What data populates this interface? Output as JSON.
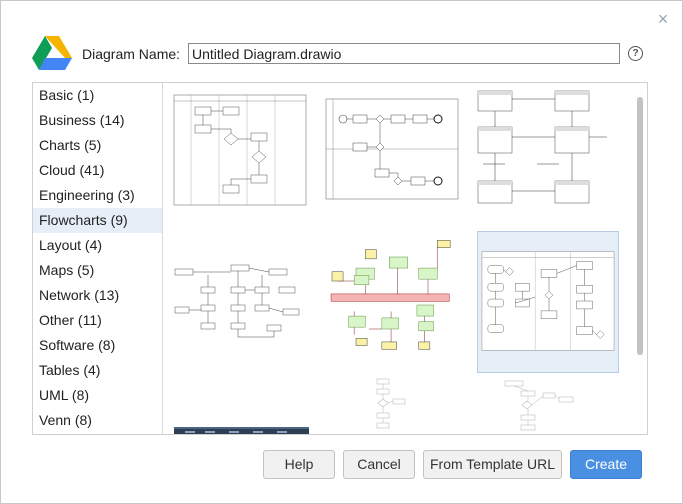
{
  "dialog": {
    "name_label": "Diagram Name:",
    "name_value": "Untitled Diagram.drawio",
    "help_glyph": "?",
    "close_glyph": "×"
  },
  "categories": [
    {
      "label": "Basic (1)"
    },
    {
      "label": "Business (14)"
    },
    {
      "label": "Charts (5)"
    },
    {
      "label": "Cloud (41)"
    },
    {
      "label": "Engineering (3)"
    },
    {
      "label": "Flowcharts (9)",
      "selected": true
    },
    {
      "label": "Layout (4)"
    },
    {
      "label": "Maps (5)"
    },
    {
      "label": "Network (13)"
    },
    {
      "label": "Other (11)"
    },
    {
      "label": "Software (8)"
    },
    {
      "label": "Tables (4)"
    },
    {
      "label": "UML (8)"
    },
    {
      "label": "Venn (8)"
    }
  ],
  "buttons": {
    "help": "Help",
    "cancel": "Cancel",
    "template_url": "From Template URL",
    "create": "Create"
  },
  "colors": {
    "accent": "#4a90e2",
    "selection": "#e6eef8",
    "drive_green": "#0f9d58",
    "drive_yellow": "#f4b400",
    "drive_blue": "#4285f4"
  }
}
